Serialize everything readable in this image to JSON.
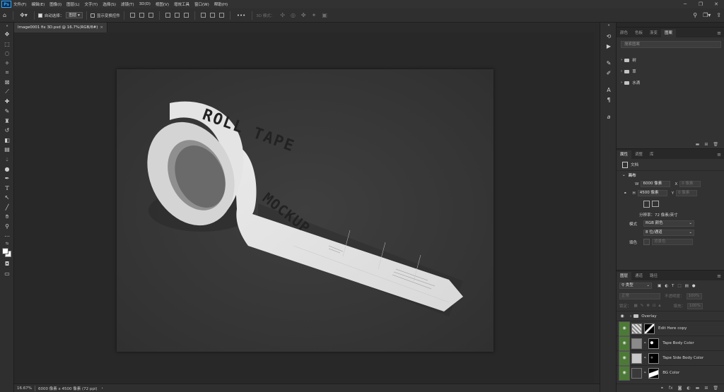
{
  "app": {
    "logo": "Ps",
    "menu": [
      "文件(F)",
      "编辑(E)",
      "图像(I)",
      "图层(L)",
      "文字(Y)",
      "选择(S)",
      "滤镜(T)",
      "3D(D)",
      "视图(V)",
      "增效工具",
      "窗口(W)",
      "帮助(H)"
    ],
    "window_controls": [
      "─",
      "❐",
      "✕"
    ]
  },
  "options_bar": {
    "auto_select_label": "自动选择：",
    "auto_select_value": "图层",
    "show_transform_label": "显示变换控件",
    "more": "•••",
    "mode_3d_label": "3D 模式：",
    "right_icons": [
      "search-icon",
      "workspace-icon",
      "share-icon"
    ]
  },
  "document": {
    "tab_title": "Image0001 fix 3D.psd @ 16.7%(RGB/8#)",
    "close": "×",
    "tape_text": "ROLL TAPE MOCKUP",
    "zoom": "16.67%",
    "doc_info": "6000 像素 x 4500 像素 (72 ppi)",
    "status_arrow": "›"
  },
  "panel_libraries": {
    "tabs": [
      "颜色",
      "色板",
      "渐变",
      "图案"
    ],
    "active_tab": 3,
    "search_placeholder": "搜索图案",
    "items": [
      "树",
      "草",
      "水滴"
    ]
  },
  "panel_properties": {
    "tabs": [
      "属性",
      "调整",
      "库"
    ],
    "active_tab": 0,
    "doc_label": "文档",
    "section": "画布",
    "w_label": "W",
    "w_value": "6000 像素",
    "h_label": "H",
    "h_value": "4500 像素",
    "x_label": "X",
    "x_value": "0 像素",
    "y_label": "Y",
    "y_value": "0 像素",
    "resolution": "分辨率：72 像素/英寸",
    "mode_label": "模式",
    "mode_value": "RGB 颜色",
    "depth_value": "8 位/通道",
    "fill_label": "填色",
    "fill_value": "背景色"
  },
  "panel_layers": {
    "tabs": [
      "图层",
      "通道",
      "路径"
    ],
    "active_tab": 0,
    "filter_kind": "类型",
    "blend_mode": "正常",
    "opacity_label": "不透明度：",
    "opacity_value": "100%",
    "lock_label": "锁定：",
    "fill_label": "填充：",
    "fill_value": "100%",
    "layers": [
      {
        "name": "Overlay",
        "type": "group"
      },
      {
        "name": "Edit Here copy",
        "type": "smart"
      },
      {
        "name": "Tape Body Color",
        "type": "fill"
      },
      {
        "name": "Tape Side Body Color",
        "type": "fill"
      },
      {
        "name": "BG Color",
        "type": "fill"
      }
    ],
    "footer_icons": [
      "link-icon",
      "fx-icon",
      "mask-icon",
      "adjustment-icon",
      "group-icon",
      "new-layer-icon",
      "delete-icon"
    ]
  }
}
